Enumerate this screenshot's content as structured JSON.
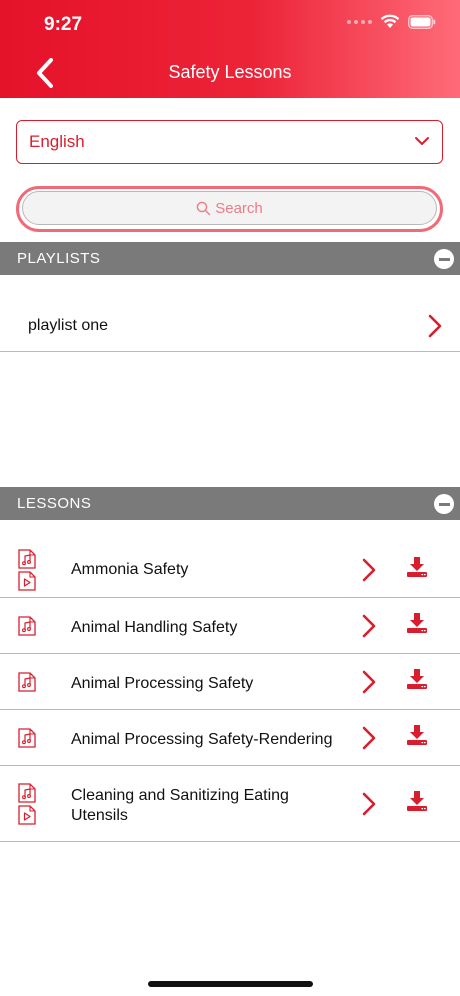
{
  "status": {
    "time": "9:27"
  },
  "nav": {
    "title": "Safety Lessons"
  },
  "language": {
    "selected": "English"
  },
  "search": {
    "placeholder": "Search"
  },
  "playlists": {
    "header": "PLAYLISTS",
    "items": [
      {
        "label": "playlist one"
      }
    ]
  },
  "lessons": {
    "header": "LESSONS",
    "items": [
      {
        "label": "Ammonia Safety",
        "media": [
          "audio",
          "video"
        ]
      },
      {
        "label": "Animal Handling Safety",
        "media": [
          "audio"
        ]
      },
      {
        "label": "Animal Processing Safety",
        "media": [
          "audio"
        ]
      },
      {
        "label": "Animal Processing Safety-Rendering",
        "media": [
          "audio"
        ]
      },
      {
        "label": "Cleaning and Sanitizing Eating Utensils",
        "media": [
          "audio",
          "video"
        ]
      }
    ]
  },
  "colors": {
    "accent": "#d81e2e",
    "section_bg": "#7a7a7a",
    "divider": "#f0a2a8"
  },
  "icons": {
    "back": "chevron-left-icon",
    "dropdown": "chevron-down-icon",
    "search": "search-icon",
    "collapse": "minus-circle-icon",
    "row_open": "chevron-right-icon",
    "audio_file": "audio-file-icon",
    "video_file": "video-file-icon",
    "download": "download-icon"
  }
}
